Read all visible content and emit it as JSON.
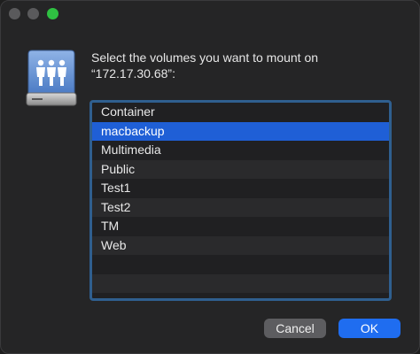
{
  "dialog": {
    "prompt_line1": "Select the volumes you want to mount on",
    "prompt_line2": "“172.17.30.68”:",
    "icon": "network-share-drive-icon"
  },
  "volumes": [
    {
      "label": "Container",
      "selected": false
    },
    {
      "label": "macbackup",
      "selected": true
    },
    {
      "label": "Multimedia",
      "selected": false
    },
    {
      "label": "Public",
      "selected": false
    },
    {
      "label": "Test1",
      "selected": false
    },
    {
      "label": "Test2",
      "selected": false
    },
    {
      "label": "TM",
      "selected": false
    },
    {
      "label": "Web",
      "selected": false
    }
  ],
  "buttons": {
    "cancel_label": "Cancel",
    "ok_label": "OK"
  },
  "colors": {
    "selection": "#1f5fd6",
    "default_button": "#1f6df0",
    "focus_ring": "#2f5f8f"
  }
}
